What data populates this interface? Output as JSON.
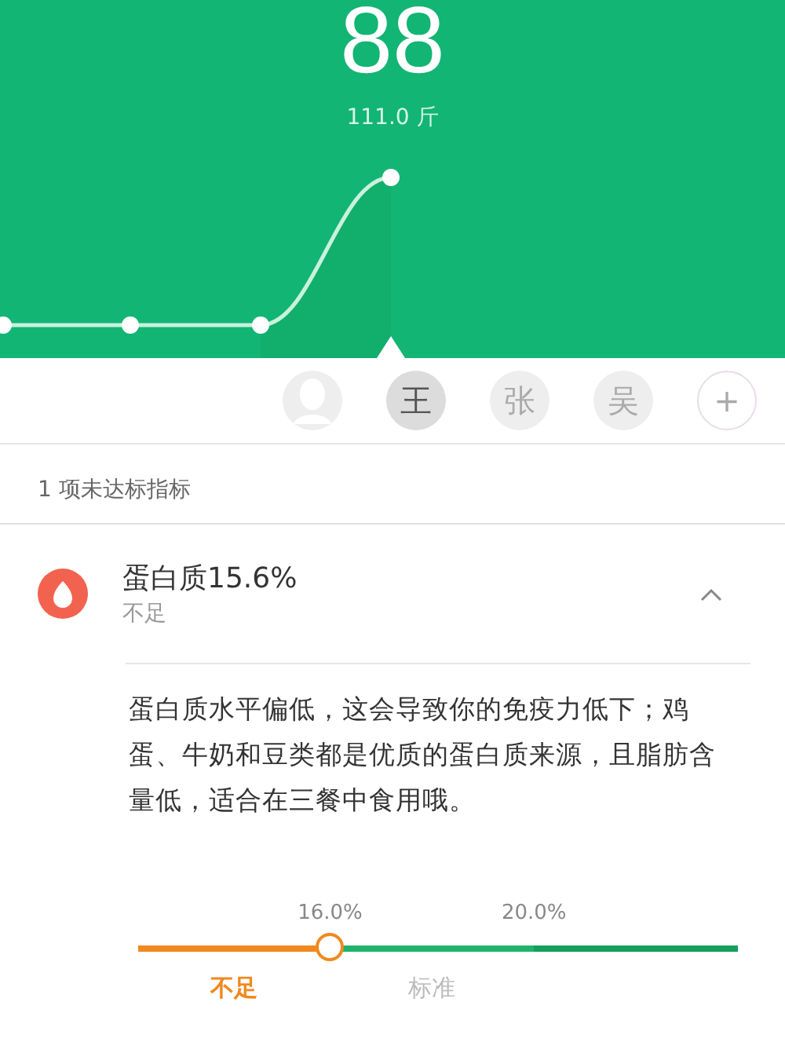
{
  "header": {
    "score": "88",
    "weight": "111.0 斤"
  },
  "users": [
    {
      "kind": "avatar",
      "selected": false
    },
    {
      "kind": "initial",
      "label": "王",
      "selected": true
    },
    {
      "kind": "initial",
      "label": "张",
      "selected": false
    },
    {
      "kind": "initial",
      "label": "吴",
      "selected": false
    },
    {
      "kind": "add",
      "label": "+",
      "selected": false
    }
  ],
  "summary": "1 项未达标指标",
  "indicator": {
    "title": "蛋白质15.6%",
    "status": "不足",
    "expanded": true,
    "description": "蛋白质水平偏低，这会导致你的免疫力低下；鸡蛋、牛奶和豆类都是优质的蛋白质来源，且脂肪含量低，适合在三餐中食用哦。"
  },
  "scale": {
    "level": 0.32,
    "ticks": [
      "16.0%",
      "20.0%"
    ],
    "segments": [
      {
        "color": "#f0891f"
      },
      {
        "color": "#1fb36a"
      },
      {
        "color": "#12a05a"
      }
    ],
    "labels": [
      {
        "text": "不足",
        "selected": true
      },
      {
        "text": "标准",
        "selected": false
      }
    ]
  }
}
